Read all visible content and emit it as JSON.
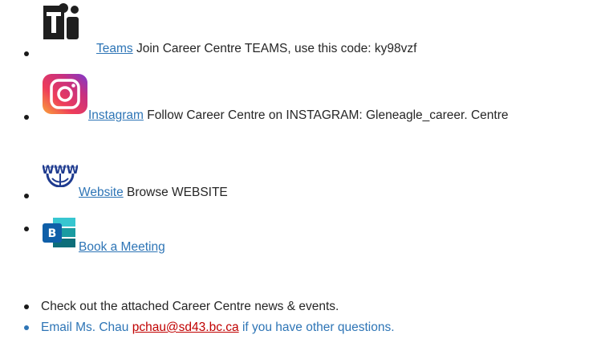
{
  "items": [
    {
      "icon": "teams-icon",
      "link_text": "Teams",
      "text": " Join Career Centre TEAMS, use this code: ky98vzf"
    },
    {
      "icon": "instagram-icon",
      "link_text": "Instagram",
      "text": " Follow Career Centre on INSTAGRAM: Gleneagle_career. Centre"
    },
    {
      "icon": "www-globe-icon",
      "icon_text": "WWW",
      "link_text": "Website",
      "text": " Browse WEBSITE"
    },
    {
      "icon": "bookings-icon",
      "icon_text": "B",
      "link_text": "Book a Meeting"
    }
  ],
  "news_text": "Check out the attached Career Centre news & events.",
  "email": {
    "prefix": "Email Ms. Chau ",
    "address": "pchau@sd43.bc.ca",
    "suffix": " if you have other questions."
  },
  "colors": {
    "link": "#2e75b6",
    "email_link": "#c00000",
    "teams_dark": "#1f1f1f",
    "bookings_blue": "#0f5fa8"
  }
}
